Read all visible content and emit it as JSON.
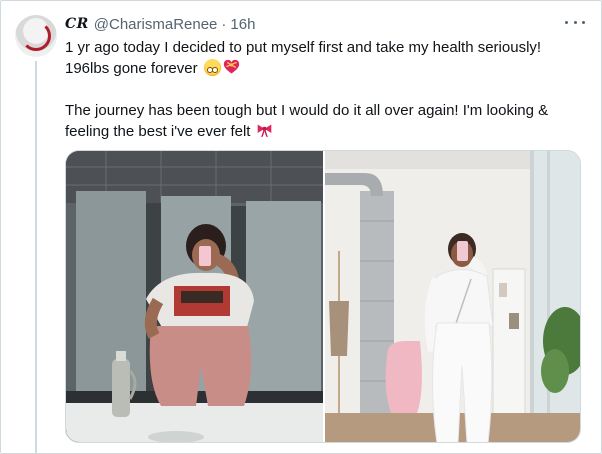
{
  "tweet": {
    "display_name": "CR",
    "handle": "@CharismaRenee",
    "separator": "·",
    "time": "16h",
    "lines": [
      "1 yr ago today I decided to put myself first and take my health seriously!",
      "196lbs gone forever",
      "The journey has been tough but I would do it all over again! I'm looking &",
      "feeling the best i've ever felt"
    ],
    "emojis": [
      "pleading-face",
      "heart-with-ribbon",
      "ribbon"
    ]
  },
  "media": {
    "photos": [
      {
        "name": "before-photo",
        "description_visible": false
      },
      {
        "name": "after-photo",
        "description_visible": false
      }
    ]
  },
  "colors": {
    "text": "#0f1419",
    "secondary": "#536471",
    "border": "#cfd9de",
    "accent_red": "#e0245e"
  }
}
